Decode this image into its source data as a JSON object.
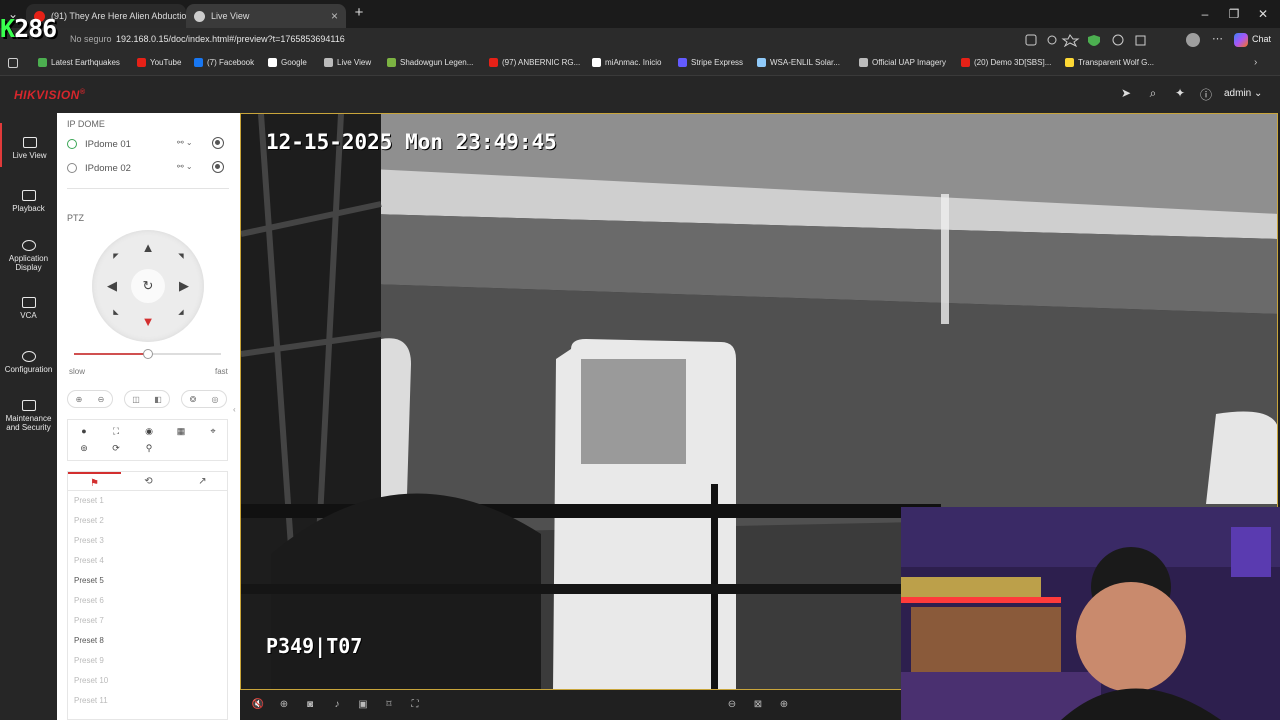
{
  "browser": {
    "tabs": [
      {
        "title": "(91) They Are Here Alien Abductio",
        "icon_color": "#e62117"
      },
      {
        "title": "Live View",
        "icon_color": "#cccccc"
      }
    ],
    "address": {
      "security": "No seguro",
      "url": "192.168.0.15/doc/index.html#/preview?t=1765853694116"
    },
    "chat_label": "Chat",
    "bookmarks": [
      {
        "label": "Latest Earthquakes",
        "icon": "map-icon",
        "color": "#4caf50"
      },
      {
        "label": "YouTube",
        "icon": "youtube-icon",
        "color": "#e62117"
      },
      {
        "label": "(7) Facebook",
        "icon": "facebook-icon",
        "color": "#1877f2"
      },
      {
        "label": "Google",
        "icon": "google-icon",
        "color": "#ffffff"
      },
      {
        "label": "Live View",
        "icon": "globe-icon",
        "color": "#bbbbbb"
      },
      {
        "label": "Shadowgun Legen...",
        "icon": "android-icon",
        "color": "#7cb342"
      },
      {
        "label": "(97) ANBERNIC RG...",
        "icon": "youtube-icon",
        "color": "#e62117"
      },
      {
        "label": "miAnmac. Inicio",
        "icon": "r-icon",
        "color": "#ffffff"
      },
      {
        "label": "Stripe Express",
        "icon": "stripe-icon",
        "color": "#635bff"
      },
      {
        "label": "WSA-ENLIL Solar...",
        "icon": "noaa-icon",
        "color": "#90caf9"
      },
      {
        "label": "Official UAP Imagery",
        "icon": "globe-icon",
        "color": "#bbbbbb"
      },
      {
        "label": "(20) Demo 3D[SBS]...",
        "icon": "youtube-icon",
        "color": "#e62117"
      },
      {
        "label": "Transparent Wolf G...",
        "icon": "doc-icon",
        "color": "#fdd835"
      }
    ]
  },
  "overlay": {
    "prefix": "K",
    "number": "286"
  },
  "app": {
    "logo": "HIKVISION",
    "logo_mark": "®",
    "user": "admin",
    "nav": [
      {
        "label": "Live View",
        "icon": "monitor-icon"
      },
      {
        "label": "Playback",
        "icon": "playback-icon"
      },
      {
        "label": "Application Display",
        "icon": "app-icon"
      },
      {
        "label": "VCA",
        "icon": "vca-icon"
      },
      {
        "label": "Configuration",
        "icon": "gear-icon"
      },
      {
        "label": "Maintenance and Security",
        "icon": "wrench-icon"
      }
    ]
  },
  "panel": {
    "group_title": "IP DOME",
    "cameras": [
      "IPdome 01",
      "IPdome 02"
    ],
    "ptz_title": "PTZ",
    "speed": {
      "slow": "slow",
      "fast": "fast",
      "level": 0.5
    },
    "presets": [
      {
        "label": "Preset 1",
        "set": false
      },
      {
        "label": "Preset 2",
        "set": false
      },
      {
        "label": "Preset 3",
        "set": false
      },
      {
        "label": "Preset 4",
        "set": false
      },
      {
        "label": "Preset 5",
        "set": true
      },
      {
        "label": "Preset 6",
        "set": false
      },
      {
        "label": "Preset 7",
        "set": false
      },
      {
        "label": "Preset 8",
        "set": true
      },
      {
        "label": "Preset 9",
        "set": false
      },
      {
        "label": "Preset 10",
        "set": false
      },
      {
        "label": "Preset 11",
        "set": false
      }
    ]
  },
  "video": {
    "timestamp": "12-15-2025 Mon 23:49:45",
    "position": "P349|T07"
  }
}
